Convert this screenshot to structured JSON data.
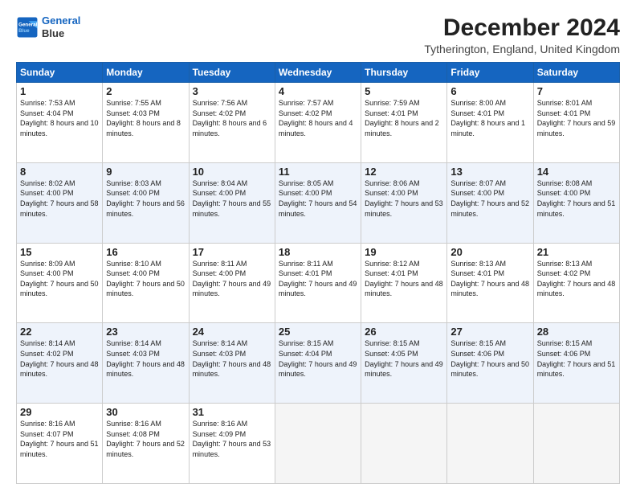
{
  "logo": {
    "line1": "General",
    "line2": "Blue"
  },
  "title": "December 2024",
  "subtitle": "Tytherington, England, United Kingdom",
  "headers": [
    "Sunday",
    "Monday",
    "Tuesday",
    "Wednesday",
    "Thursday",
    "Friday",
    "Saturday"
  ],
  "rows": [
    [
      {
        "day": "1",
        "sunrise": "Sunrise: 7:53 AM",
        "sunset": "Sunset: 4:04 PM",
        "daylight": "Daylight: 8 hours and 10 minutes."
      },
      {
        "day": "2",
        "sunrise": "Sunrise: 7:55 AM",
        "sunset": "Sunset: 4:03 PM",
        "daylight": "Daylight: 8 hours and 8 minutes."
      },
      {
        "day": "3",
        "sunrise": "Sunrise: 7:56 AM",
        "sunset": "Sunset: 4:02 PM",
        "daylight": "Daylight: 8 hours and 6 minutes."
      },
      {
        "day": "4",
        "sunrise": "Sunrise: 7:57 AM",
        "sunset": "Sunset: 4:02 PM",
        "daylight": "Daylight: 8 hours and 4 minutes."
      },
      {
        "day": "5",
        "sunrise": "Sunrise: 7:59 AM",
        "sunset": "Sunset: 4:01 PM",
        "daylight": "Daylight: 8 hours and 2 minutes."
      },
      {
        "day": "6",
        "sunrise": "Sunrise: 8:00 AM",
        "sunset": "Sunset: 4:01 PM",
        "daylight": "Daylight: 8 hours and 1 minute."
      },
      {
        "day": "7",
        "sunrise": "Sunrise: 8:01 AM",
        "sunset": "Sunset: 4:01 PM",
        "daylight": "Daylight: 7 hours and 59 minutes."
      }
    ],
    [
      {
        "day": "8",
        "sunrise": "Sunrise: 8:02 AM",
        "sunset": "Sunset: 4:00 PM",
        "daylight": "Daylight: 7 hours and 58 minutes."
      },
      {
        "day": "9",
        "sunrise": "Sunrise: 8:03 AM",
        "sunset": "Sunset: 4:00 PM",
        "daylight": "Daylight: 7 hours and 56 minutes."
      },
      {
        "day": "10",
        "sunrise": "Sunrise: 8:04 AM",
        "sunset": "Sunset: 4:00 PM",
        "daylight": "Daylight: 7 hours and 55 minutes."
      },
      {
        "day": "11",
        "sunrise": "Sunrise: 8:05 AM",
        "sunset": "Sunset: 4:00 PM",
        "daylight": "Daylight: 7 hours and 54 minutes."
      },
      {
        "day": "12",
        "sunrise": "Sunrise: 8:06 AM",
        "sunset": "Sunset: 4:00 PM",
        "daylight": "Daylight: 7 hours and 53 minutes."
      },
      {
        "day": "13",
        "sunrise": "Sunrise: 8:07 AM",
        "sunset": "Sunset: 4:00 PM",
        "daylight": "Daylight: 7 hours and 52 minutes."
      },
      {
        "day": "14",
        "sunrise": "Sunrise: 8:08 AM",
        "sunset": "Sunset: 4:00 PM",
        "daylight": "Daylight: 7 hours and 51 minutes."
      }
    ],
    [
      {
        "day": "15",
        "sunrise": "Sunrise: 8:09 AM",
        "sunset": "Sunset: 4:00 PM",
        "daylight": "Daylight: 7 hours and 50 minutes."
      },
      {
        "day": "16",
        "sunrise": "Sunrise: 8:10 AM",
        "sunset": "Sunset: 4:00 PM",
        "daylight": "Daylight: 7 hours and 50 minutes."
      },
      {
        "day": "17",
        "sunrise": "Sunrise: 8:11 AM",
        "sunset": "Sunset: 4:00 PM",
        "daylight": "Daylight: 7 hours and 49 minutes."
      },
      {
        "day": "18",
        "sunrise": "Sunrise: 8:11 AM",
        "sunset": "Sunset: 4:01 PM",
        "daylight": "Daylight: 7 hours and 49 minutes."
      },
      {
        "day": "19",
        "sunrise": "Sunrise: 8:12 AM",
        "sunset": "Sunset: 4:01 PM",
        "daylight": "Daylight: 7 hours and 48 minutes."
      },
      {
        "day": "20",
        "sunrise": "Sunrise: 8:13 AM",
        "sunset": "Sunset: 4:01 PM",
        "daylight": "Daylight: 7 hours and 48 minutes."
      },
      {
        "day": "21",
        "sunrise": "Sunrise: 8:13 AM",
        "sunset": "Sunset: 4:02 PM",
        "daylight": "Daylight: 7 hours and 48 minutes."
      }
    ],
    [
      {
        "day": "22",
        "sunrise": "Sunrise: 8:14 AM",
        "sunset": "Sunset: 4:02 PM",
        "daylight": "Daylight: 7 hours and 48 minutes."
      },
      {
        "day": "23",
        "sunrise": "Sunrise: 8:14 AM",
        "sunset": "Sunset: 4:03 PM",
        "daylight": "Daylight: 7 hours and 48 minutes."
      },
      {
        "day": "24",
        "sunrise": "Sunrise: 8:14 AM",
        "sunset": "Sunset: 4:03 PM",
        "daylight": "Daylight: 7 hours and 48 minutes."
      },
      {
        "day": "25",
        "sunrise": "Sunrise: 8:15 AM",
        "sunset": "Sunset: 4:04 PM",
        "daylight": "Daylight: 7 hours and 49 minutes."
      },
      {
        "day": "26",
        "sunrise": "Sunrise: 8:15 AM",
        "sunset": "Sunset: 4:05 PM",
        "daylight": "Daylight: 7 hours and 49 minutes."
      },
      {
        "day": "27",
        "sunrise": "Sunrise: 8:15 AM",
        "sunset": "Sunset: 4:06 PM",
        "daylight": "Daylight: 7 hours and 50 minutes."
      },
      {
        "day": "28",
        "sunrise": "Sunrise: 8:15 AM",
        "sunset": "Sunset: 4:06 PM",
        "daylight": "Daylight: 7 hours and 51 minutes."
      }
    ],
    [
      {
        "day": "29",
        "sunrise": "Sunrise: 8:16 AM",
        "sunset": "Sunset: 4:07 PM",
        "daylight": "Daylight: 7 hours and 51 minutes."
      },
      {
        "day": "30",
        "sunrise": "Sunrise: 8:16 AM",
        "sunset": "Sunset: 4:08 PM",
        "daylight": "Daylight: 7 hours and 52 minutes."
      },
      {
        "day": "31",
        "sunrise": "Sunrise: 8:16 AM",
        "sunset": "Sunset: 4:09 PM",
        "daylight": "Daylight: 7 hours and 53 minutes."
      },
      null,
      null,
      null,
      null
    ]
  ]
}
